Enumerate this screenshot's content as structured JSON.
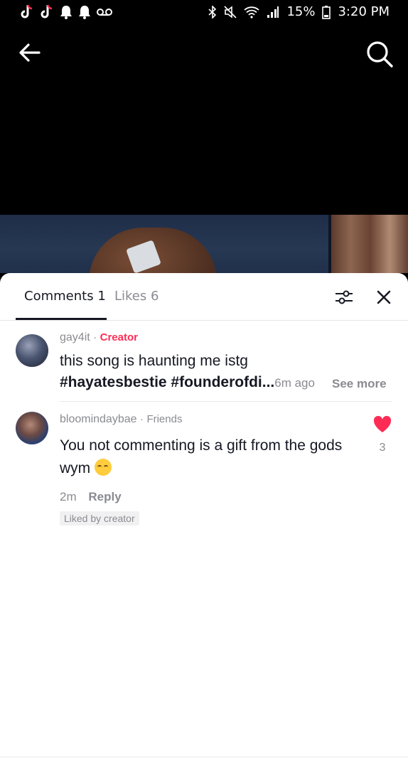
{
  "status_bar": {
    "battery": "15%",
    "time": "3:20 PM"
  },
  "tabs": {
    "comments_label": "Comments",
    "comments_count": "1",
    "likes_label": "Likes",
    "likes_count": "6"
  },
  "comments": [
    {
      "username": "gay4it",
      "badge": "Creator",
      "text_line1": "this song is haunting me istg",
      "text_line2": "#hayatesbestie #founderofdi...",
      "time": "6m ago",
      "see_more": "See more"
    },
    {
      "username": "bloomindaybae",
      "badge": "Friends",
      "text": "You not commenting is a gift from the gods wym",
      "time": "2m",
      "reply": "Reply",
      "liked_tag": "Liked by creator",
      "like_count": "3"
    }
  ],
  "colors": {
    "accent": "#fe2c55",
    "text_primary": "#161823",
    "text_secondary": "#8a8b91"
  }
}
